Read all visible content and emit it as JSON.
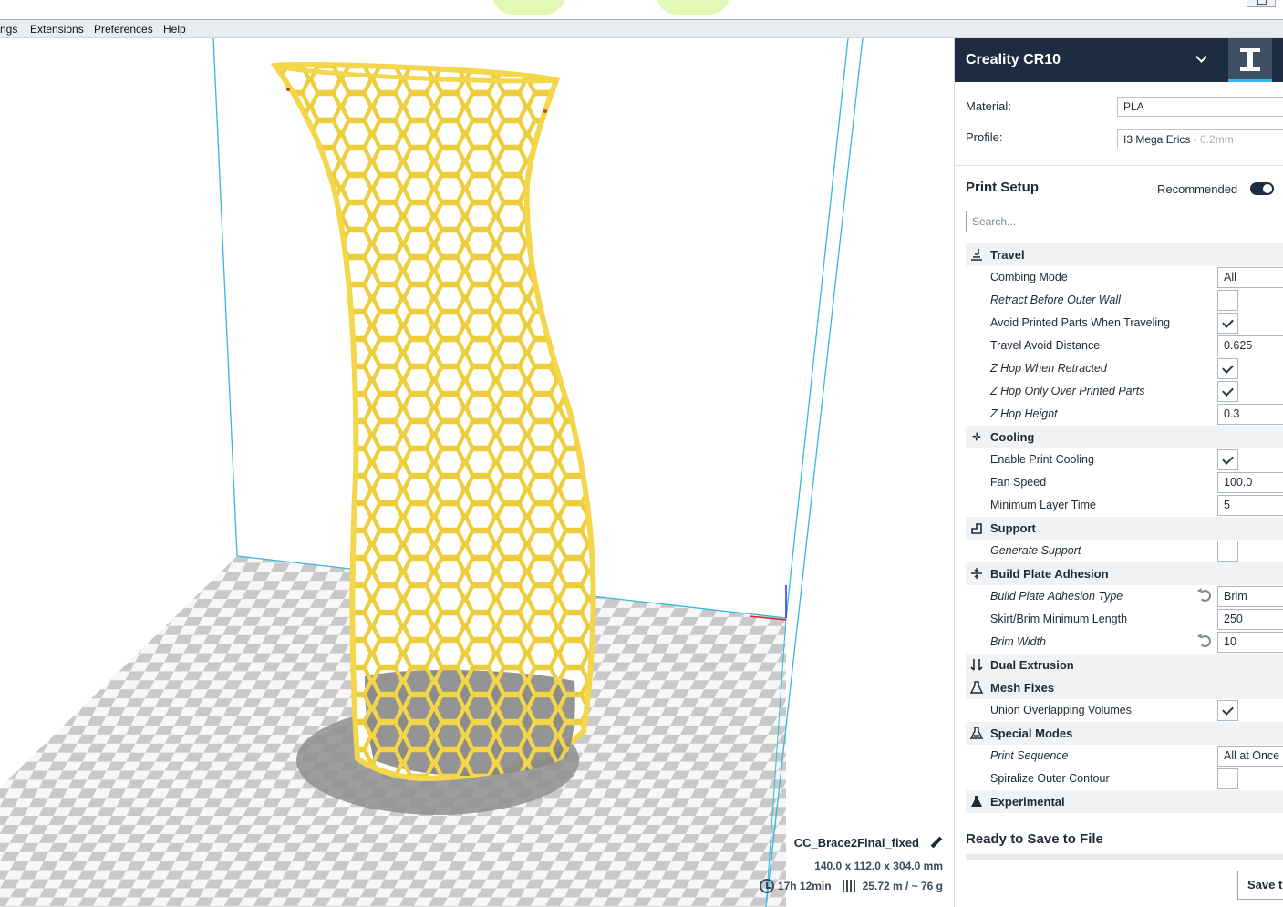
{
  "menu": [
    "ngs",
    "Extensions",
    "Preferences",
    "Help"
  ],
  "machine": {
    "name": "Creality CR10"
  },
  "material": {
    "label": "Material:",
    "value": "PLA"
  },
  "profile": {
    "label": "Profile:",
    "value": "I3 Mega Erics",
    "suffix": " - 0.2mm"
  },
  "print_setup": {
    "title": "Print Setup",
    "mode_label": "Recommended",
    "search_placeholder": "Search..."
  },
  "settings": [
    {
      "kind": "category",
      "label": "Travel",
      "icon": "travel-icon"
    },
    {
      "kind": "select",
      "label": "Combing Mode",
      "value": "All",
      "italic": false
    },
    {
      "kind": "check",
      "label": "Retract Before Outer Wall",
      "checked": false,
      "italic": true
    },
    {
      "kind": "check",
      "label": "Avoid Printed Parts When Traveling",
      "checked": true,
      "italic": false
    },
    {
      "kind": "value",
      "label": "Travel Avoid Distance",
      "value": "0.625",
      "italic": false
    },
    {
      "kind": "check",
      "label": "Z Hop When Retracted",
      "checked": true,
      "italic": true
    },
    {
      "kind": "check",
      "label": "Z Hop Only Over Printed Parts",
      "checked": true,
      "italic": true
    },
    {
      "kind": "value",
      "label": "Z Hop Height",
      "value": "0.3",
      "italic": true
    },
    {
      "kind": "category",
      "label": "Cooling",
      "icon": "fan-icon"
    },
    {
      "kind": "check",
      "label": "Enable Print Cooling",
      "checked": true,
      "italic": false
    },
    {
      "kind": "value",
      "label": "Fan Speed",
      "value": "100.0",
      "italic": false
    },
    {
      "kind": "value",
      "label": "Minimum Layer Time",
      "value": "5",
      "italic": false
    },
    {
      "kind": "category",
      "label": "Support",
      "icon": "support-icon"
    },
    {
      "kind": "check",
      "label": "Generate Support",
      "checked": false,
      "italic": true
    },
    {
      "kind": "category",
      "label": "Build Plate Adhesion",
      "icon": "adhesion-icon"
    },
    {
      "kind": "select",
      "label": "Build Plate Adhesion Type",
      "value": "Brim",
      "italic": true,
      "reset": true
    },
    {
      "kind": "value",
      "label": "Skirt/Brim Minimum Length",
      "value": "250",
      "italic": false
    },
    {
      "kind": "value",
      "label": "Brim Width",
      "value": "10",
      "italic": true,
      "reset": true
    },
    {
      "kind": "category",
      "label": "Dual Extrusion",
      "icon": "dual-extrusion-icon"
    },
    {
      "kind": "category",
      "label": "Mesh Fixes",
      "icon": "mesh-fixes-icon"
    },
    {
      "kind": "check",
      "label": "Union Overlapping Volumes",
      "checked": true,
      "italic": false
    },
    {
      "kind": "category",
      "label": "Special Modes",
      "icon": "special-modes-icon"
    },
    {
      "kind": "select",
      "label": "Print Sequence",
      "value": "All at Once",
      "italic": true
    },
    {
      "kind": "check",
      "label": "Spiralize Outer Contour",
      "checked": false,
      "italic": false
    },
    {
      "kind": "category",
      "label": "Experimental",
      "icon": "experimental-icon"
    }
  ],
  "ready": {
    "title": "Ready to Save to File",
    "save_label": "Save t"
  },
  "model": {
    "filename": "CC_Brace2Final_fixed",
    "dimensions": "140.0 x 112.0 x 304.0 mm",
    "time": "17h 12min",
    "material_usage": "25.72 m / ~ 76 g"
  },
  "colors": {
    "model_yellow": "#f6df5a",
    "header_dark": "#1d2c3e",
    "accent_blue": "#35b7f0"
  }
}
